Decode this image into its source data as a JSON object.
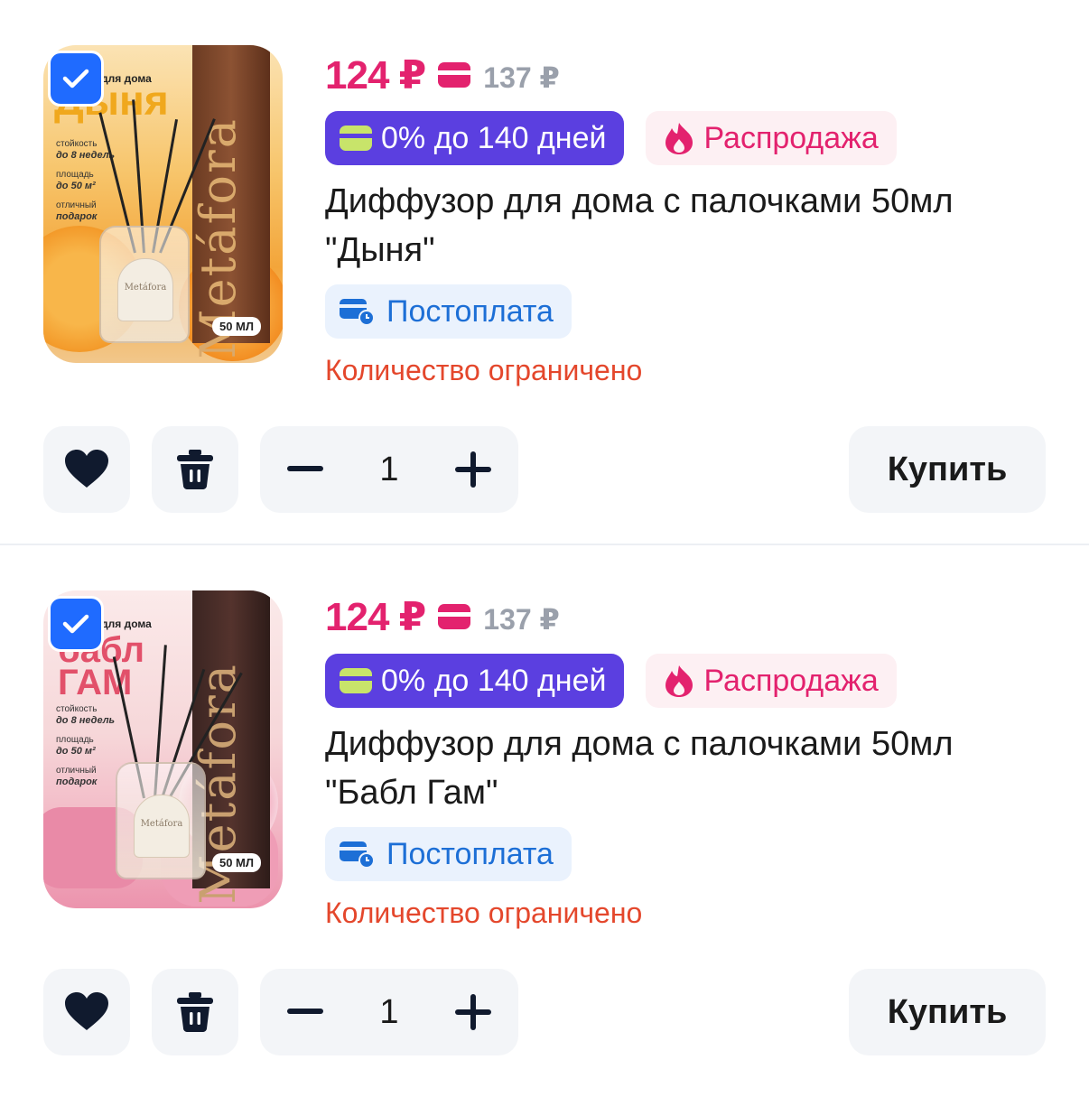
{
  "colors": {
    "price": "#e3226e",
    "installment_bg": "#5b3fe0",
    "sale_text": "#e3226e",
    "postpay_text": "#1d6fd6",
    "limited_text": "#e4472c",
    "checkbox": "#1f6bff"
  },
  "items": [
    {
      "price": "124 ₽",
      "old_price": "137 ₽",
      "installment": "0% до 140 дней",
      "sale": "Распродажа",
      "title_line1": "Диффузор для дома с палочками 50мл",
      "title_line2": "\"Дыня\"",
      "postpay": "Постоплата",
      "limited": "Количество ограничено",
      "quantity": "1",
      "buy": "Купить",
      "checked": true,
      "image": {
        "header": "для дома",
        "big": "Дыня",
        "durability_label": "стойкость",
        "durability_value": "до 8 недель",
        "area_label": "площадь",
        "area_value": "до 50 м²",
        "gift_label": "отличный",
        "gift_value": "подарок",
        "brand": "Metáfora",
        "volume": "50 МЛ"
      }
    },
    {
      "price": "124 ₽",
      "old_price": "137 ₽",
      "installment": "0% до 140 дней",
      "sale": "Распродажа",
      "title_line1": "Диффузор для дома с палочками 50мл",
      "title_line2": "\"Бабл Гам\"",
      "postpay": "Постоплата",
      "limited": "Количество ограничено",
      "quantity": "1",
      "buy": "Купить",
      "checked": true,
      "image": {
        "header": "для дома",
        "big_line1": "бабл",
        "big_line2": "ГАМ",
        "durability_label": "стойкость",
        "durability_value": "до 8 недель",
        "area_label": "площадь",
        "area_value": "до 50 м²",
        "gift_label": "отличный",
        "gift_value": "подарок",
        "brand": "Metáfora",
        "volume": "50 МЛ"
      }
    }
  ]
}
